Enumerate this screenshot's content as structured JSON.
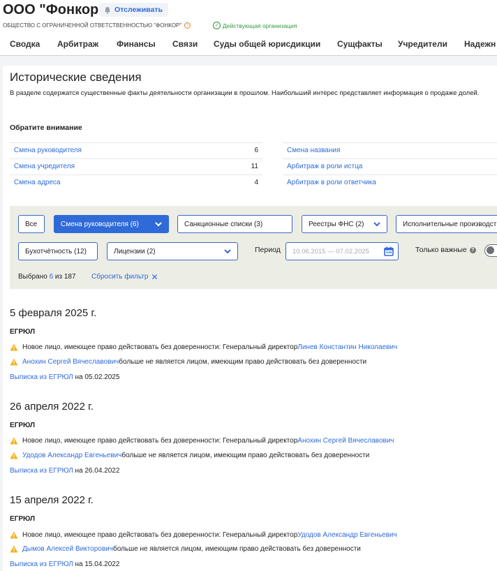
{
  "company": {
    "name": "ООО \"Фонкор\"",
    "track_label": "Отслеживать",
    "full_name": "ОБЩЕСТВО С ОГРАНИЧЕННОЙ ОТВЕТСТВЕННОСТЬЮ \"ФОНКОР\"",
    "status": "Действующая организация"
  },
  "tabs": [
    "Сводка",
    "Арбитраж",
    "Финансы",
    "Связи",
    "Суды общей юрисдикции",
    "Сущфакты",
    "Учредители",
    "Надежн"
  ],
  "section": {
    "title": "Исторические сведения",
    "description": "В разделе содержатся существенные факты деятельности организации в прошлом. Наибольший интерес представляет информация о продаже долей."
  },
  "attention": {
    "title": "Обратите внимание",
    "left": [
      {
        "label": "Смена руководителя",
        "count": "6"
      },
      {
        "label": "Смена учредителя",
        "count": "11"
      },
      {
        "label": "Смена адреса",
        "count": "4"
      }
    ],
    "right": [
      {
        "label": "Смена названия"
      },
      {
        "label": "Арбитраж в роли истца"
      },
      {
        "label": "Арбитраж в роли ответчика"
      }
    ]
  },
  "filters": {
    "all": "Все",
    "director_change": "Смена руководителя (6)",
    "sanctions": "Санкционные списки (3)",
    "fns_registers": "Реестры ФНС (2)",
    "enforcement": "Исполнительные производства",
    "accounting": "Бухотчётность (12)",
    "licenses": "Лицензии (2)",
    "period_label": "Период",
    "period_value": "10.06.2015 — 07.02.2025",
    "only_important": "Только важные",
    "selected_prefix": "Выбрано ",
    "selected_count": "6",
    "selected_suffix": " из 187",
    "reset": "Сбросить фильтр"
  },
  "colors": {
    "accent": "#2f6bd8",
    "warning": "#f2b01e",
    "panel": "#ecede5",
    "status_green": "#2f9a3c"
  },
  "events": [
    {
      "date": "5 февраля 2025 г.",
      "source": "ЕГРЮЛ",
      "line1_text": "Новое лицо, имеющее право действовать без доверенности: Генеральный директор ",
      "line1_person": "Линев Константин Николаевич",
      "line2_person": "Анохин Сергей Вячеславович",
      "line2_text": " больше не является лицом, имеющим право действовать без доверенности",
      "extract_link": "Выписка из ЕГРЮЛ",
      "extract_date": " на 05.02.2025"
    },
    {
      "date": "26 апреля 2022 г.",
      "source": "ЕГРЮЛ",
      "line1_text": "Новое лицо, имеющее право действовать без доверенности: Генеральный директор ",
      "line1_person": "Анохин Сергей Вячеславович",
      "line2_person": "Удодов Александр Евгеньевич",
      "line2_text": " больше не является лицом, имеющим право действовать без доверенности",
      "extract_link": "Выписка из ЕГРЮЛ",
      "extract_date": " на 26.04.2022"
    },
    {
      "date": "15 апреля 2022 г.",
      "source": "ЕГРЮЛ",
      "line1_text": "Новое лицо, имеющее право действовать без доверенности: Генеральный директор ",
      "line1_person": "Удодов Александр Евгеньевич",
      "line2_person": "Дымов Алексей Викторович",
      "line2_text": " больше не является лицом, имеющим право действовать без доверенности",
      "extract_link": "Выписка из ЕГРЮЛ",
      "extract_date": " на 15.04.2022"
    }
  ]
}
